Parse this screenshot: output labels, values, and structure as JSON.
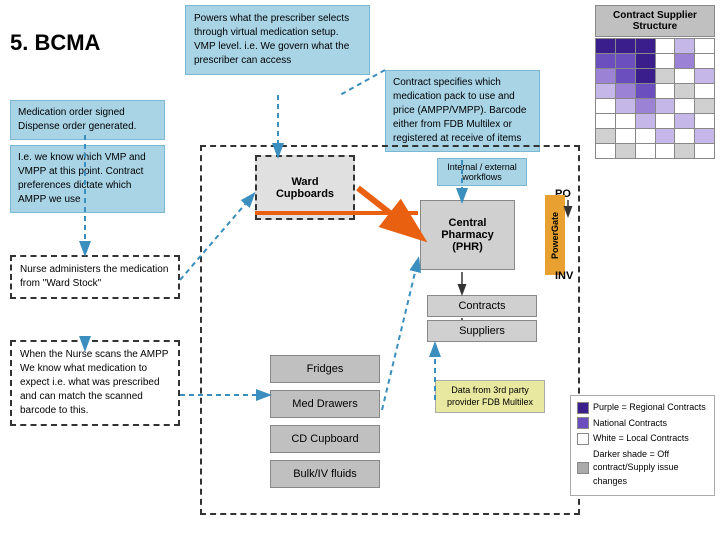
{
  "title": "5. BCMA",
  "tooltip_top": {
    "text": "Powers what the prescriber selects through virtual medication setup. VMP level. i.e. We govern what the prescriber can access"
  },
  "contract_supplier": {
    "header": "Contract Supplier Structure"
  },
  "med_order_box": {
    "text": "Medication order signed\nDispense order generated."
  },
  "vmp_box": {
    "text": "I.e. we know which VMP and VMPP at this point. Contract preferences dictate which AMPP we use"
  },
  "contract_spec_box": {
    "text": "Contract specifies which medication pack to use and price (AMPP/VMPP). Barcode either from FDB Multilex or registered at receive of items"
  },
  "ward_cupboards": "Ward\nCupboards",
  "workflows": "Internal / external\nworkflows",
  "pharmacy": "Central\nPharmacy\n(PHR)",
  "po": "PO",
  "powergate": "PowerGate",
  "inv": "INV",
  "contracts": "Contracts",
  "suppliers": "Suppliers",
  "nurse_box": "Nurse administers the medication from \"Ward Stock\"",
  "nurse_scan_box": "When the Nurse scans the AMPP We know what medication to expect i.e. what was prescribed and can match the scanned barcode to this.",
  "fridges": "Fridges",
  "med_drawers": "Med Drawers",
  "cd_cupboard": "CD Cupboard",
  "bulk_iv": "Bulk/IV fluids",
  "data_box": "Data from 3rd party provider FDB Multilex",
  "legend": {
    "purple_label": "Purple = Regional Contracts",
    "national_label": "National Contracts",
    "white_label": "White = Local Contracts",
    "darker_label": "Darker shade = Off contract/Supply issue changes"
  }
}
